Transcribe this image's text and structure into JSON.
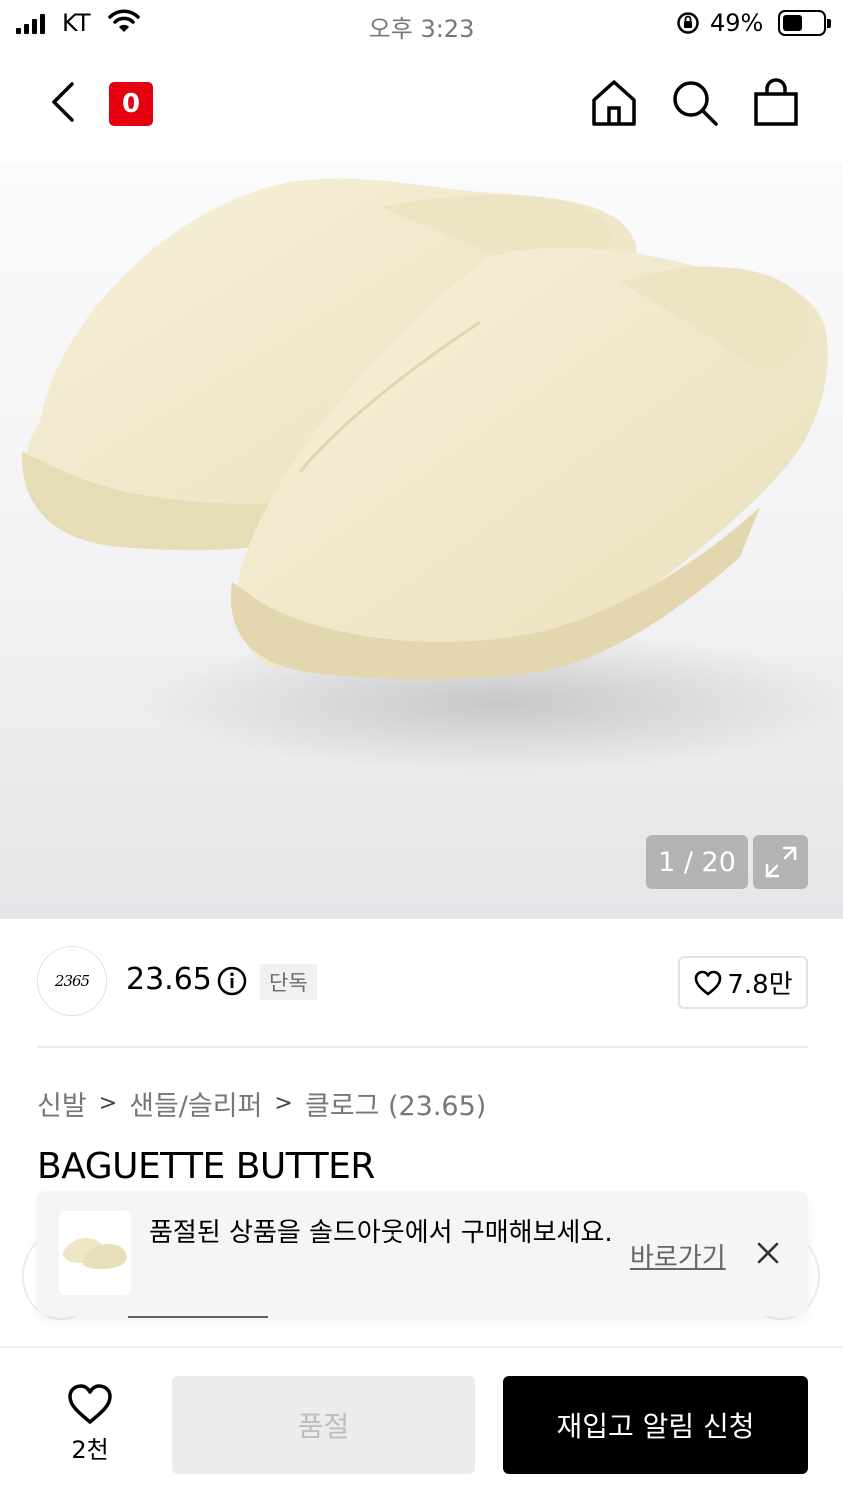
{
  "status_bar": {
    "carrier": "KT",
    "time": "오후 3:23",
    "battery_percent": "49%",
    "battery_level": 0.49
  },
  "nav": {
    "cart_badge": "0",
    "icons": [
      "back-icon",
      "home-icon",
      "search-icon",
      "bag-icon"
    ]
  },
  "gallery": {
    "counter": "1 / 20",
    "current": 1,
    "total": 20
  },
  "brand": {
    "logo_text": "2365",
    "name": "23.65",
    "exclusive_tag": "단독",
    "likes": "7.8만"
  },
  "breadcrumb": {
    "items": [
      "신발",
      "샌들/슬리퍼",
      "클로그 (23.65)"
    ]
  },
  "product": {
    "title": "BAGUETTE BUTTER"
  },
  "toast": {
    "message": "품절된 상품을 솔드아웃에서 구매해보세요.",
    "action": "바로가기"
  },
  "bottom_bar": {
    "wish_count": "2천",
    "soldout_label": "품절",
    "restock_label": "재입고 알림 신청"
  },
  "colors": {
    "badge_red": "#e4000f",
    "primary_button": "#000000",
    "disabled_button": "#ececec",
    "product_color": "#f2ebcf"
  }
}
